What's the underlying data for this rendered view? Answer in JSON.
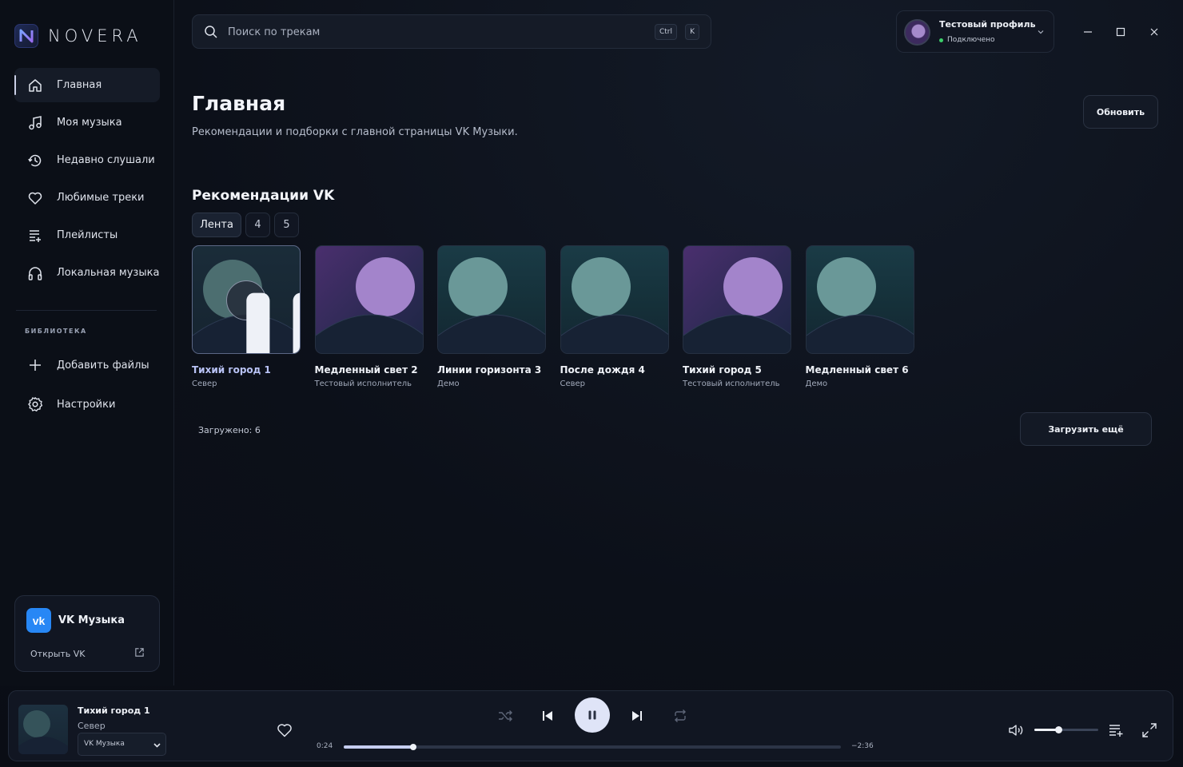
{
  "app": {
    "name": "NOVERA"
  },
  "sidebar": {
    "nav": [
      {
        "label": "Главная",
        "icon": "home-icon",
        "active": true
      },
      {
        "label": "Моя музыка",
        "icon": "music-note-icon"
      },
      {
        "label": "Недавно слушали",
        "icon": "history-icon"
      },
      {
        "label": "Любимые треки",
        "icon": "heart-icon"
      },
      {
        "label": "Плейлисты",
        "icon": "playlist-icon"
      },
      {
        "label": "Локальная музыка",
        "icon": "headphones-icon"
      }
    ],
    "library_title": "БИБЛИОТЕКА",
    "library": [
      {
        "label": "Добавить файлы",
        "icon": "plus-icon"
      },
      {
        "label": "Настройки",
        "icon": "gear-icon"
      }
    ],
    "vk_card": {
      "logo": "vk",
      "title": "VK Музыка",
      "open_label": "Открыть VK"
    }
  },
  "search": {
    "placeholder": "Поиск по трекам",
    "shortcut": [
      "Ctrl",
      "K"
    ]
  },
  "profile": {
    "name": "Тестовый профиль",
    "status": "Подключено"
  },
  "main": {
    "title": "Главная",
    "subtitle": "Рекомендации и подборки с главной страницы VK Музыки.",
    "refresh_label": "Обновить",
    "section_title": "Рекомендации VK",
    "tabs": [
      {
        "label": "Лента",
        "active": true
      },
      {
        "label": "4"
      },
      {
        "label": "5"
      }
    ],
    "tracks": [
      {
        "title": "Тихий город 1",
        "artist": "Север",
        "theme": "teal",
        "playing": true
      },
      {
        "title": "Медленный свет 2",
        "artist": "Тестовый исполнитель",
        "theme": "purple"
      },
      {
        "title": "Линии горизонта 3",
        "artist": "Демо",
        "theme": "teal"
      },
      {
        "title": "После дождя 4",
        "artist": "Север",
        "theme": "teal"
      },
      {
        "title": "Тихий город 5",
        "artist": "Тестовый исполнитель",
        "theme": "purple"
      },
      {
        "title": "Медленный свет 6",
        "artist": "Демо",
        "theme": "teal"
      }
    ],
    "loaded_label": "Загружено: 6",
    "load_more_label": "Загрузить ещё"
  },
  "player": {
    "title": "Тихий город 1",
    "artist": "Север",
    "source": "VK Музыка",
    "elapsed": "0:24",
    "remaining": "−2:36",
    "progress": 0.14,
    "volume": 0.38
  },
  "colors": {
    "accent": "#c5cdf0",
    "vk": "#2787f5",
    "online": "#3ccf6a"
  }
}
